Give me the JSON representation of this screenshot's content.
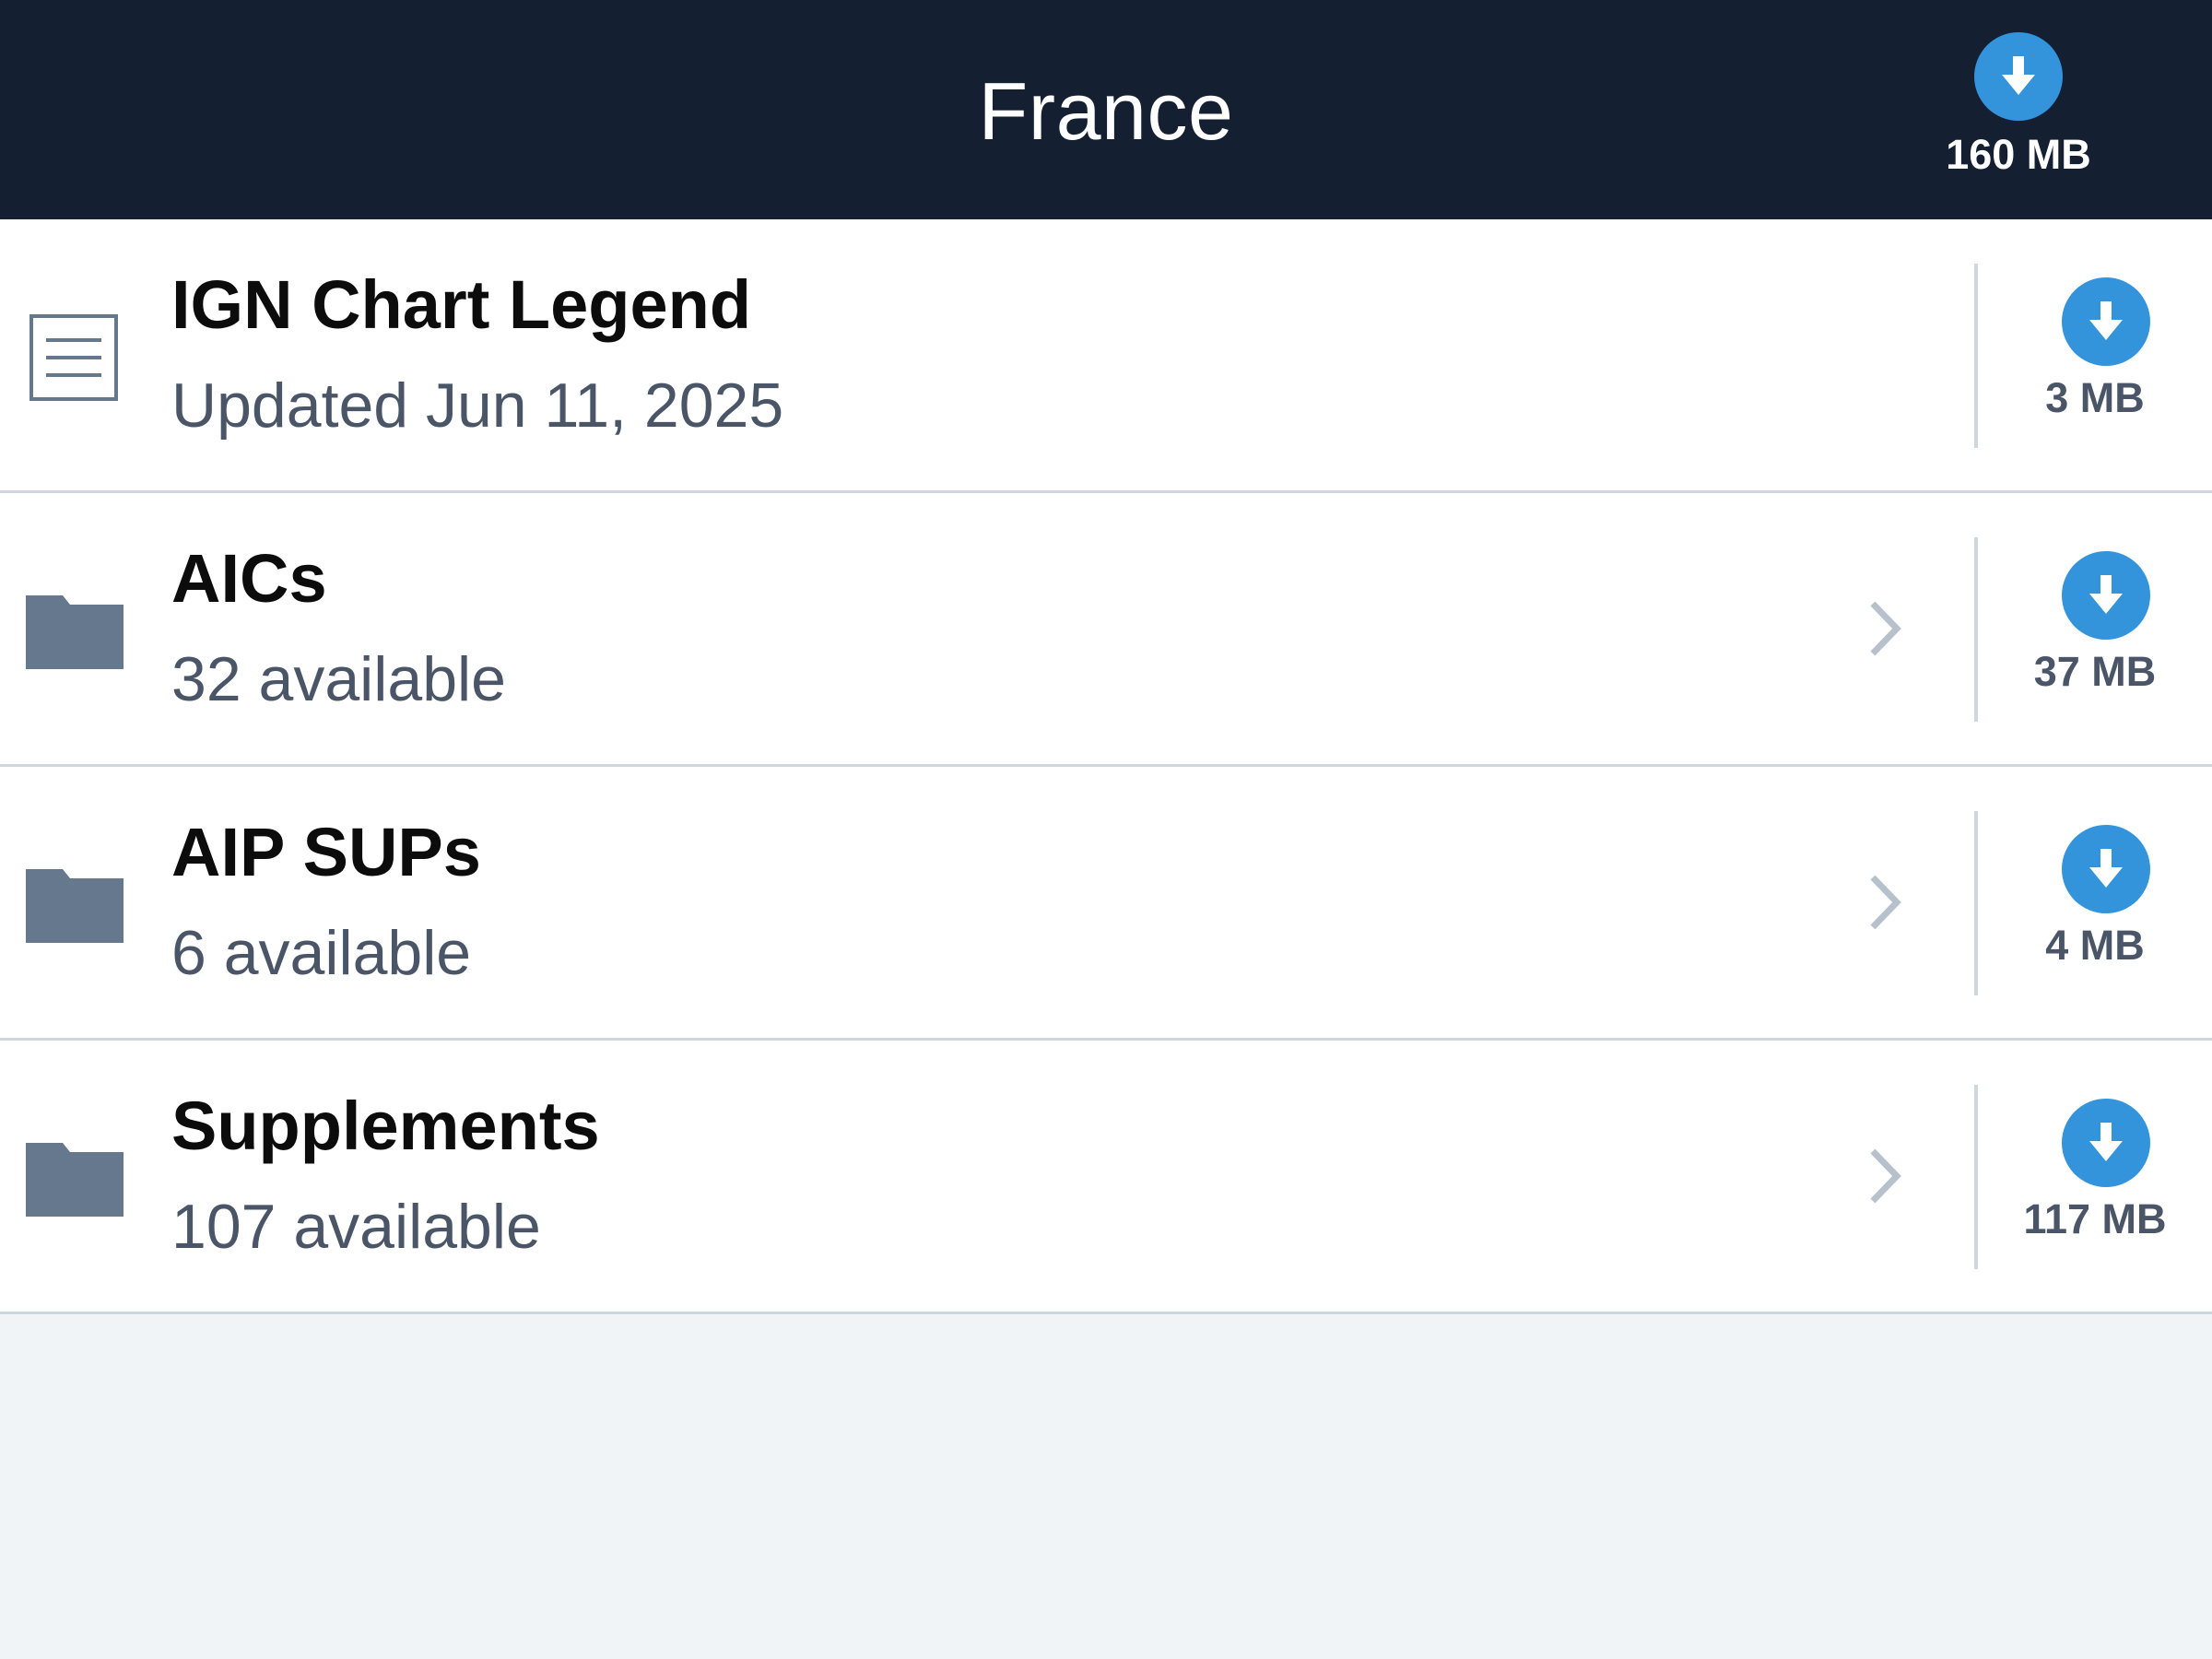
{
  "header": {
    "title": "France",
    "download_size": "160 MB",
    "download_icon": "download-arrow-icon"
  },
  "colors": {
    "navbar_bg": "#142031",
    "accent": "#3394db",
    "folder": "#65788d",
    "subtitle": "#4a5667",
    "page_bg": "#f0f4f7"
  },
  "items": [
    {
      "title": "IGN Chart Legend",
      "subtitle": "Updated Jun 11, 2025",
      "size": "3 MB",
      "icon": "document-icon",
      "has_chevron": false
    },
    {
      "title": "AICs",
      "subtitle": "32 available",
      "size": "37 MB",
      "icon": "folder-icon",
      "has_chevron": true
    },
    {
      "title": "AIP SUPs",
      "subtitle": "6 available",
      "size": "4 MB",
      "icon": "folder-icon",
      "has_chevron": true
    },
    {
      "title": "Supplements",
      "subtitle": "107 available",
      "size": "117 MB",
      "icon": "folder-icon",
      "has_chevron": true
    }
  ]
}
